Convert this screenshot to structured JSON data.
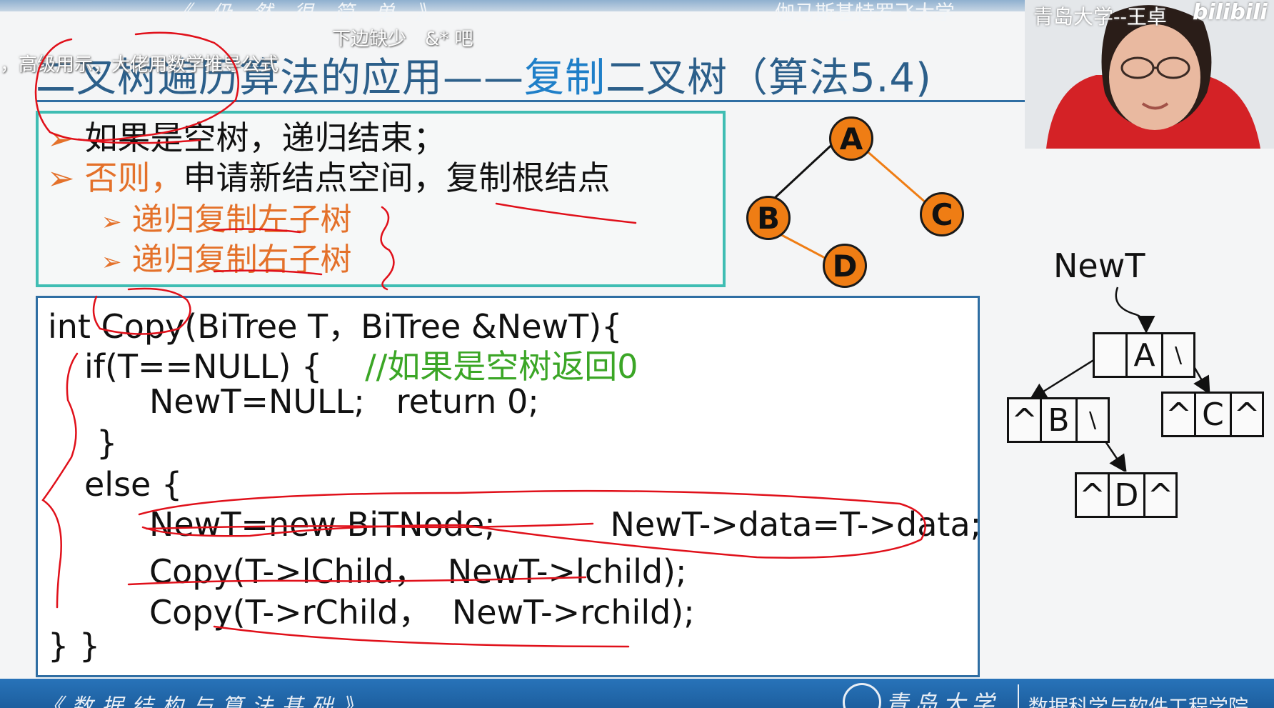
{
  "top": {
    "left_text": "《 仍 然 很 简 单 》",
    "right_text": "伽马斯基特罗飞大学"
  },
  "danmaku": [
    "下边缺少　&* 吧",
    "，高级用示，大佬用数学推导公式"
  ],
  "slide": {
    "title_part1": "二叉树遍历算法的应用——",
    "title_part2": "复制",
    "title_part3": "二叉树（算法5.4)",
    "bullets": [
      {
        "arrow": "➢",
        "text": "如果是空树，递归结束；"
      },
      {
        "arrow": "➢",
        "lead": "否则，",
        "text": "申请新结点空间，复制根结点"
      },
      {
        "arrow": "➢",
        "text": "递归复制左子树"
      },
      {
        "arrow": "➢",
        "text": "递归复制右子树"
      }
    ],
    "tree_nodes": [
      "A",
      "B",
      "C",
      "D"
    ],
    "code": {
      "line1": "int Copy(BiTree T，BiTree &NewT){",
      "line2_code": "if(T==NULL) {",
      "line2_comment": "//如果是空树返回0",
      "line3": "NewT=NULL;   return 0;",
      "line4": "}",
      "line5": "else {",
      "line6": "NewT=new BiTNode;           NewT->data=T->data;",
      "line7": "Copy(T->lChild，  NewT->lchild);",
      "line8": "Copy(T->rChild，  NewT->rchild);",
      "line9": "} }"
    },
    "newt": {
      "label": "NewT",
      "node_a": [
        "",
        "A",
        "\\"
      ],
      "node_b": [
        "^",
        "B",
        "\\"
      ],
      "node_c": [
        "^",
        "C",
        "^"
      ],
      "node_d": [
        "^",
        "D",
        "^"
      ]
    }
  },
  "webcam": {
    "watermark": "青岛大学--王卓",
    "platform_logo": "bilibili"
  },
  "footer": {
    "course": "《数据结构与算法基础》",
    "school": "青岛大学",
    "department": "数据科学与软件工程学院"
  },
  "colors": {
    "title": "#2c5f8a",
    "title_highlight": "#1f7fc8",
    "accent_orange": "#e4712a",
    "comment_green": "#3ba626",
    "box_border": "#3fbdb3",
    "ink_red": "#e0101a"
  }
}
